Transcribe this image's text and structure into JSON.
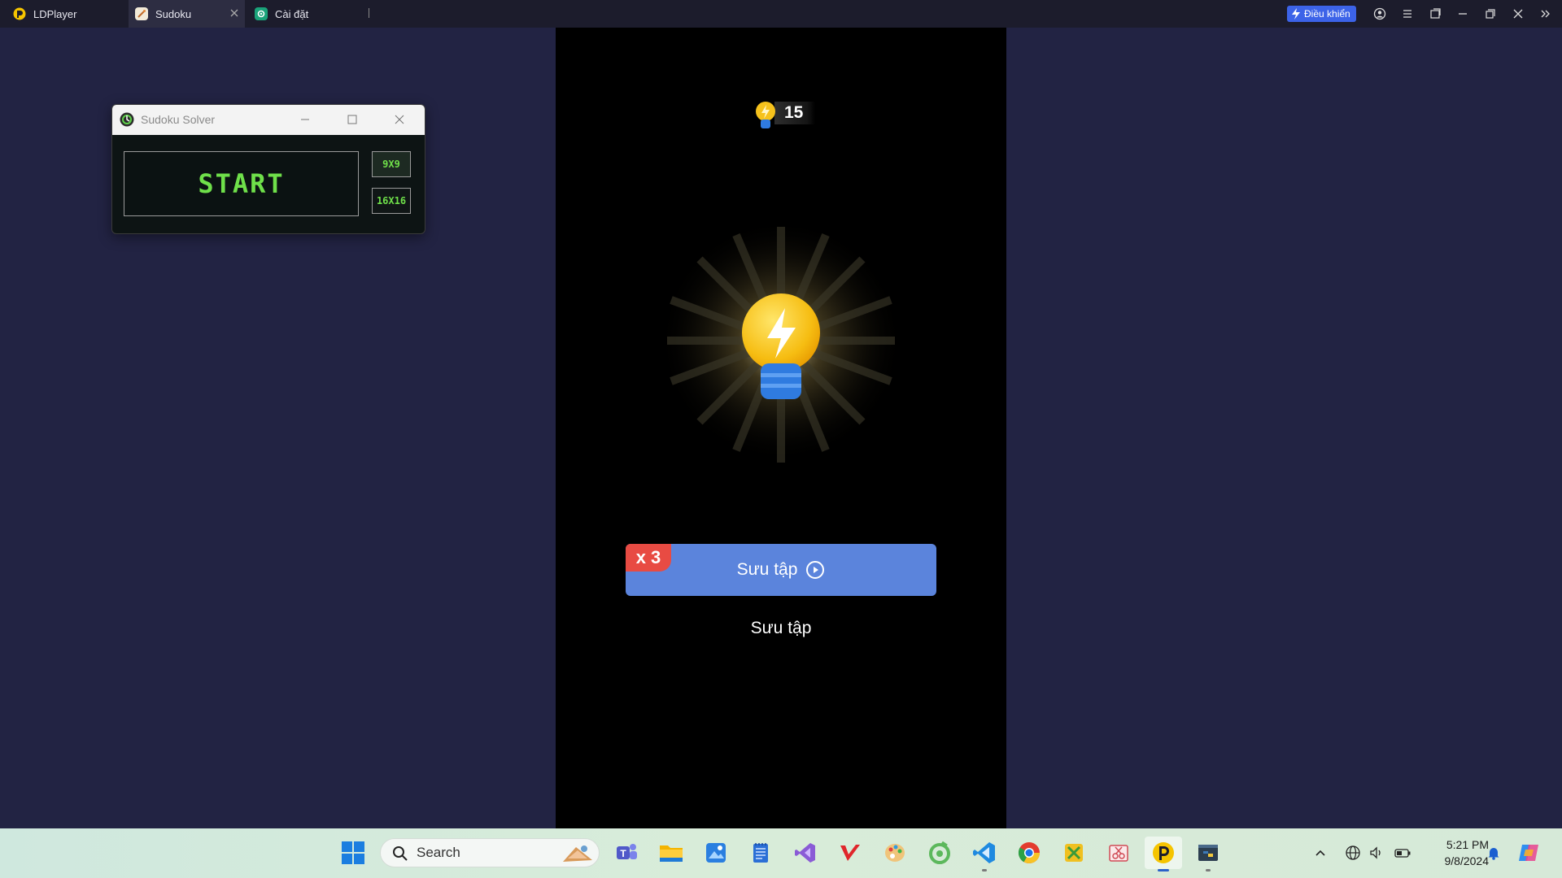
{
  "titlebar": {
    "tabs": [
      {
        "label": "LDPlayer"
      },
      {
        "label": "Sudoku"
      },
      {
        "label": "Cài đặt"
      }
    ],
    "control_button": "Điều khiển"
  },
  "solver_window": {
    "title": "Sudoku Solver",
    "start_label": "START",
    "size_9": "9X9",
    "size_16": "16X16"
  },
  "game": {
    "hint_count": "15",
    "multiplier": "x 3",
    "collect_button": "Sưu tập",
    "collect_text": "Sưu tập"
  },
  "taskbar": {
    "search_placeholder": "Search",
    "time": "5:21 PM",
    "date": "9/8/2024",
    "pinned_apps": [
      "start",
      "search",
      "teams",
      "file-explorer",
      "photos",
      "notepad",
      "visual-studio",
      "app-v",
      "paint",
      "coccoc",
      "vscode",
      "chrome",
      "app-yellow",
      "snipping",
      "ldplayer",
      "python"
    ]
  },
  "colors": {
    "desktop_bg": "#222343",
    "collect_button": "#5b84dc",
    "multiplier_badge": "#e84b43",
    "solver_accent": "#6fe04a",
    "ldplayer_yellow": "#f5c400"
  }
}
